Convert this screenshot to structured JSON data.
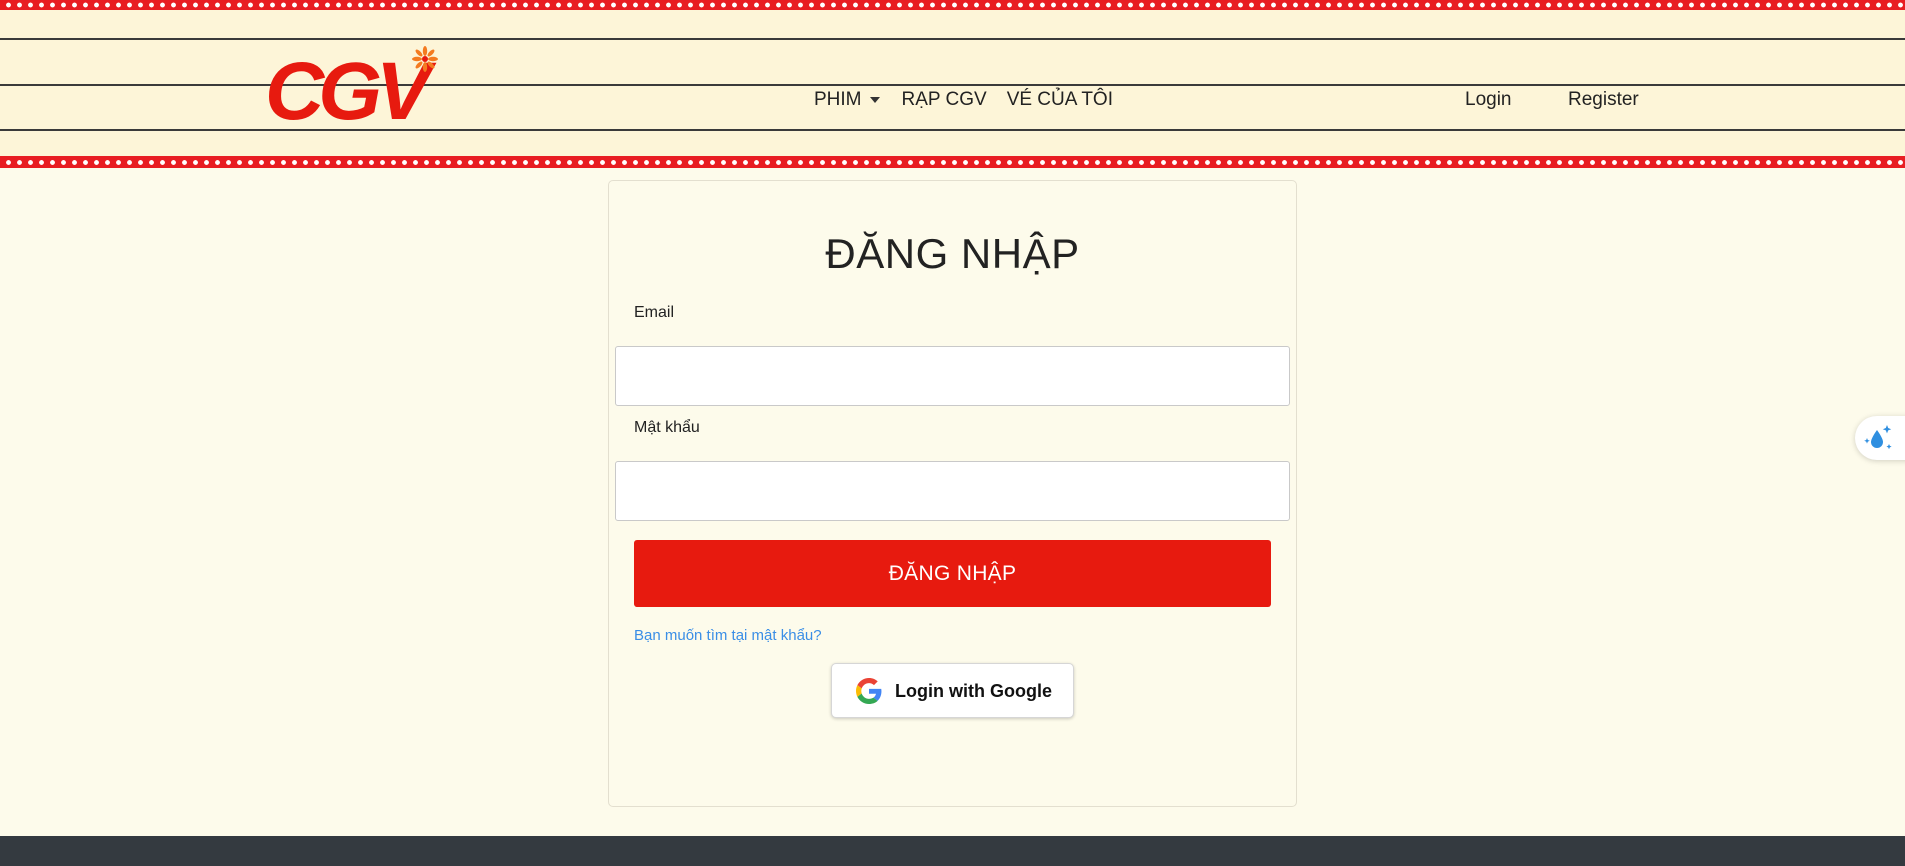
{
  "brand": {
    "logo_text": "CGV",
    "logo_color": "#e71a0f",
    "accent_star_color": "#f47b20"
  },
  "nav": {
    "items": [
      {
        "label": "PHIM",
        "has_dropdown": true
      },
      {
        "label": "RẠP CGV",
        "has_dropdown": false
      },
      {
        "label": "VÉ CỦA TÔI",
        "has_dropdown": false
      }
    ],
    "login_label": "Login",
    "register_label": "Register"
  },
  "login_form": {
    "title": "ĐĂNG NHẬP",
    "email_label": "Email",
    "email_value": "",
    "password_label": "Mật khẩu",
    "password_value": "",
    "submit_label": "ĐĂNG NHẬP",
    "forgot_link": "Bạn muốn tìm tại mật khẩu?",
    "google_button_label": "Login with Google"
  },
  "colors": {
    "primary_red": "#e71a0f",
    "header_bg": "#fdf5d8",
    "page_bg": "#fdfbeb",
    "link_blue": "#3a8ee6",
    "footer_bg": "#343a40"
  },
  "icons": {
    "dropdown": "caret-down-icon",
    "google": "google-g-icon",
    "widget": "water-drop-sparkle-icon"
  }
}
